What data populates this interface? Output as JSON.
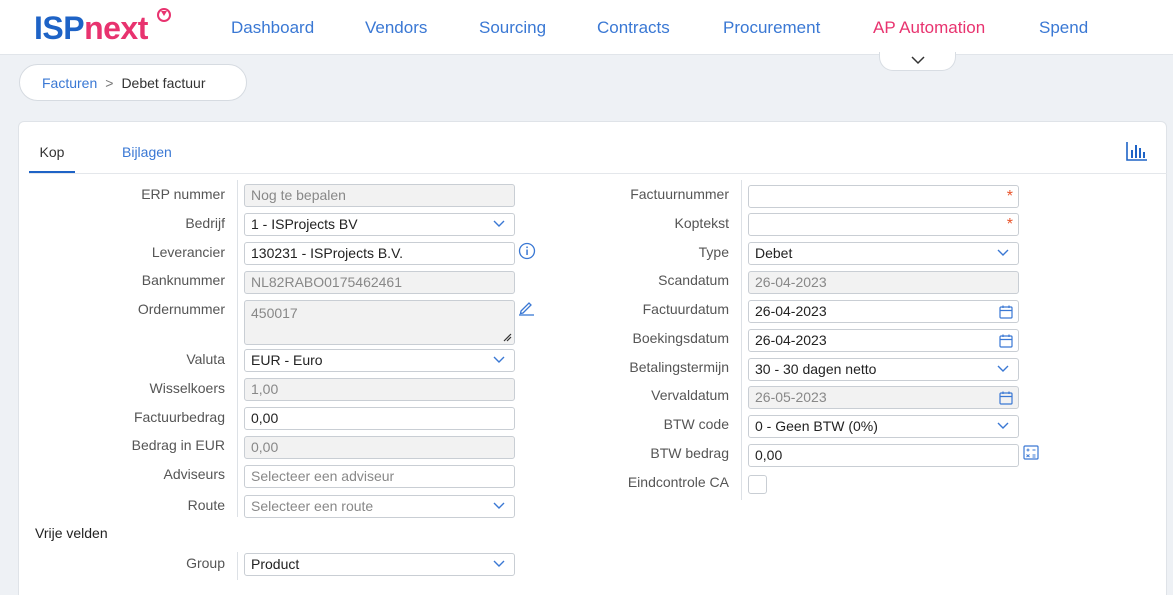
{
  "logo": {
    "part1": "ISP",
    "part2": "next"
  },
  "nav": [
    {
      "label": "Dashboard",
      "active": false
    },
    {
      "label": "Vendors",
      "active": false
    },
    {
      "label": "Sourcing",
      "active": false
    },
    {
      "label": "Contracts",
      "active": false
    },
    {
      "label": "Procurement",
      "active": false
    },
    {
      "label": "AP Automation",
      "active": true
    },
    {
      "label": "Spend",
      "active": false
    }
  ],
  "breadcrumb": {
    "parent": "Facturen",
    "separator": ">",
    "current": "Debet factuur"
  },
  "tabs": {
    "kop": "Kop",
    "bijlagen": "Bijlagen"
  },
  "form_left": {
    "erp": {
      "label": "ERP nummer",
      "value": "Nog te bepalen"
    },
    "bedrijf": {
      "label": "Bedrijf",
      "value": "1 - ISProjects BV"
    },
    "leverancier": {
      "label": "Leverancier",
      "value": "130231 - ISProjects B.V."
    },
    "banknummer": {
      "label": "Banknummer",
      "value": "NL82RABO0175462461"
    },
    "ordernummer": {
      "label": "Ordernummer",
      "value": "450017"
    },
    "valuta": {
      "label": "Valuta",
      "value": "EUR - Euro"
    },
    "wisselkoers": {
      "label": "Wisselkoers",
      "value": "1,00"
    },
    "factuurbedrag": {
      "label": "Factuurbedrag",
      "value": "0,00"
    },
    "bedrag_eur": {
      "label": "Bedrag in EUR",
      "value": "0,00"
    },
    "adviseurs": {
      "label": "Adviseurs",
      "placeholder": "Selecteer een adviseur"
    },
    "route": {
      "label": "Route",
      "placeholder": "Selecteer een route"
    }
  },
  "form_right": {
    "factuurnummer": {
      "label": "Factuurnummer",
      "value": ""
    },
    "koptekst": {
      "label": "Koptekst",
      "value": ""
    },
    "type": {
      "label": "Type",
      "value": "Debet"
    },
    "scandatum": {
      "label": "Scandatum",
      "value": "26-04-2023"
    },
    "factuurdatum": {
      "label": "Factuurdatum",
      "value": "26-04-2023"
    },
    "boekingsdatum": {
      "label": "Boekingsdatum",
      "value": "26-04-2023"
    },
    "betalingstermijn": {
      "label": "Betalingstermijn",
      "value": "30 - 30 dagen netto"
    },
    "vervaldatum": {
      "label": "Vervaldatum",
      "value": "26-05-2023"
    },
    "btw_code": {
      "label": "BTW code",
      "value": "0 - Geen BTW (0%)"
    },
    "btw_bedrag": {
      "label": "BTW bedrag",
      "value": "0,00"
    },
    "eindcontrole": {
      "label": "Eindcontrole CA",
      "checked": false
    }
  },
  "vrije_velden": {
    "title": "Vrije velden",
    "group": {
      "label": "Group",
      "value": "Product"
    }
  },
  "required_mark": "*",
  "colors": {
    "primary": "#1e63c6",
    "accent": "#e8336f",
    "link": "#3a78d4",
    "required": "#e8542b"
  }
}
